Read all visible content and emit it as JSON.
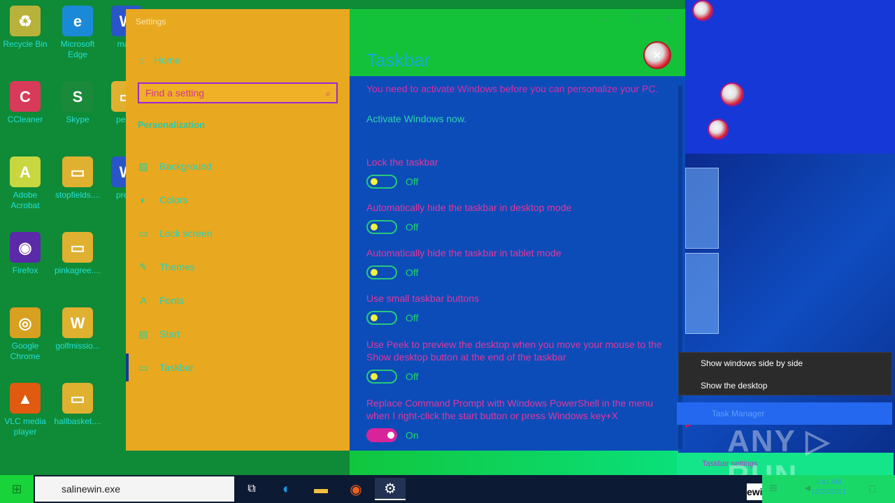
{
  "desktop": {
    "icons": [
      {
        "label": "Recycle Bin",
        "glyph": "♻",
        "color": "#b9b23a"
      },
      {
        "label": "Microsoft Edge",
        "glyph": "e",
        "color": "#1a8ad8"
      },
      {
        "label": "mark",
        "glyph": "W",
        "color": "#2a55c8"
      },
      {
        "label": "CCleaner",
        "glyph": "C",
        "color": "#d83a5a"
      },
      {
        "label": "Skype",
        "glyph": "S",
        "color": "#1a8a3a"
      },
      {
        "label": "perso",
        "glyph": "▭",
        "color": "#e0b030"
      },
      {
        "label": "Adobe Acrobat",
        "glyph": "A",
        "color": "#c8d640"
      },
      {
        "label": "stopfields....",
        "glyph": "▭",
        "color": "#e0b030"
      },
      {
        "label": "prese",
        "glyph": "W",
        "color": "#2a55c8"
      },
      {
        "label": "Firefox",
        "glyph": "◉",
        "color": "#5a2aa8"
      },
      {
        "label": "pinkagree....",
        "glyph": "▭",
        "color": "#e0b030"
      },
      {
        "label": "Google Chrome",
        "glyph": "◎",
        "color": "#d8a020"
      },
      {
        "label": "golfmissio...",
        "glyph": "W",
        "color": "#e0b030"
      },
      {
        "label": "VLC media player",
        "glyph": "▲",
        "color": "#e05a10"
      },
      {
        "label": "hallbasket....",
        "glyph": "▭",
        "color": "#e0b030"
      }
    ]
  },
  "settings": {
    "window_title": "Settings",
    "home_label": "Home",
    "search_placeholder": "Find a setting",
    "section_label": "Personalization",
    "nav": [
      {
        "label": "Background",
        "icon": "image-icon",
        "glyph": "▨"
      },
      {
        "label": "Colors",
        "icon": "palette-icon",
        "glyph": "◐"
      },
      {
        "label": "Lock screen",
        "icon": "lock-screen-icon",
        "glyph": "▭"
      },
      {
        "label": "Themes",
        "icon": "themes-icon",
        "glyph": "✎"
      },
      {
        "label": "Fonts",
        "icon": "fonts-icon",
        "glyph": "A"
      },
      {
        "label": "Start",
        "icon": "start-icon",
        "glyph": "▤"
      },
      {
        "label": "Taskbar",
        "icon": "taskbar-icon",
        "glyph": "▭"
      }
    ],
    "page_title": "Taskbar",
    "activate_message": "You need to activate Windows before you can personalize your PC.",
    "activate_link": "Activate Windows now.",
    "options": [
      {
        "label": "Lock the taskbar",
        "state": "Off"
      },
      {
        "label": "Automatically hide the taskbar in desktop mode",
        "state": "Off"
      },
      {
        "label": "Automatically hide the taskbar in tablet mode",
        "state": "Off"
      },
      {
        "label": "Use small taskbar buttons",
        "state": "Off"
      },
      {
        "label": "Use Peek to preview the desktop when you move your mouse to the Show desktop button at the end of the taskbar",
        "state": "Off"
      },
      {
        "label": "Replace Command Prompt with Windows PowerShell in the menu when I right-click the start button or press Windows key+X",
        "state": "On"
      }
    ]
  },
  "context_menu": {
    "items": [
      "Show windows side by side",
      "Show the desktop"
    ],
    "task_manager": "Task Manager",
    "taskbar_settings": "Taskbar settings"
  },
  "taskbar": {
    "search_value": "salinewin.exe",
    "ewi_label": "ewi",
    "clock_time": "1:41 AM",
    "clock_date": "12/26/2021"
  },
  "watermark": "ANY ▷ RUN"
}
